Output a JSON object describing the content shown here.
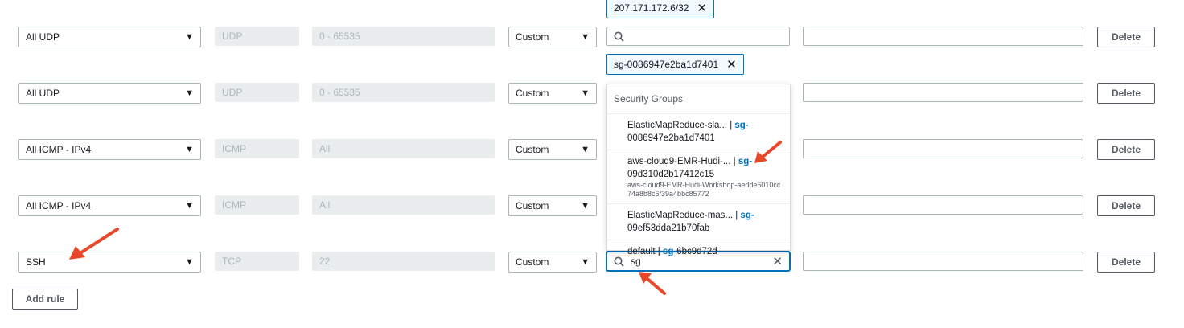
{
  "rows": [
    {
      "type": "All UDP",
      "protocol": "UDP",
      "port_range": "0 - 65535",
      "source_type": "Custom",
      "delete_label": "Delete"
    },
    {
      "type": "All UDP",
      "protocol": "UDP",
      "port_range": "0 - 65535",
      "source_type": "Custom",
      "delete_label": "Delete"
    },
    {
      "type": "All ICMP - IPv4",
      "protocol": "ICMP",
      "port_range": "All",
      "source_type": "Custom",
      "delete_label": "Delete"
    },
    {
      "type": "All ICMP - IPv4",
      "protocol": "ICMP",
      "port_range": "All",
      "source_type": "Custom",
      "delete_label": "Delete"
    },
    {
      "type": "SSH",
      "protocol": "TCP",
      "port_range": "22",
      "source_type": "Custom",
      "delete_label": "Delete"
    }
  ],
  "tokens": {
    "row1": "207.171.172.6/32",
    "row2": "sg-0086947e2ba1d7401"
  },
  "source_search_value": "sg",
  "dropdown": {
    "header": "Security Groups",
    "items": [
      {
        "name": "ElasticMapReduce-sla...",
        "sep": " | ",
        "sg_prefix": "sg-",
        "sg_id": "0086947e2ba1d7401",
        "desc": ""
      },
      {
        "name": "aws-cloud9-EMR-Hudi-...",
        "sep": " | ",
        "sg_prefix": "sg-",
        "sg_id": "09d310d2b17412c15",
        "desc": "aws-cloud9-EMR-Hudi-Workshop-aedde6010cc74a8b8c6f39a4bbc85772"
      },
      {
        "name": "ElasticMapReduce-mas...",
        "sep": " | ",
        "sg_prefix": "sg-",
        "sg_id": "09ef53dda21b70fab",
        "desc": ""
      },
      {
        "name": "default",
        "sep": " | ",
        "sg_prefix": "sg-",
        "sg_id": "6bc9d72d",
        "desc": ""
      }
    ]
  },
  "add_rule_label": "Add rule",
  "icons": {
    "search": "search-icon",
    "close": "close-icon",
    "caret": "caret-down-icon",
    "arrow": "red-pointer-arrow"
  },
  "colors": {
    "accent": "#0073bb",
    "arrow": "#e8472a",
    "readonly_bg": "#eaeded"
  }
}
